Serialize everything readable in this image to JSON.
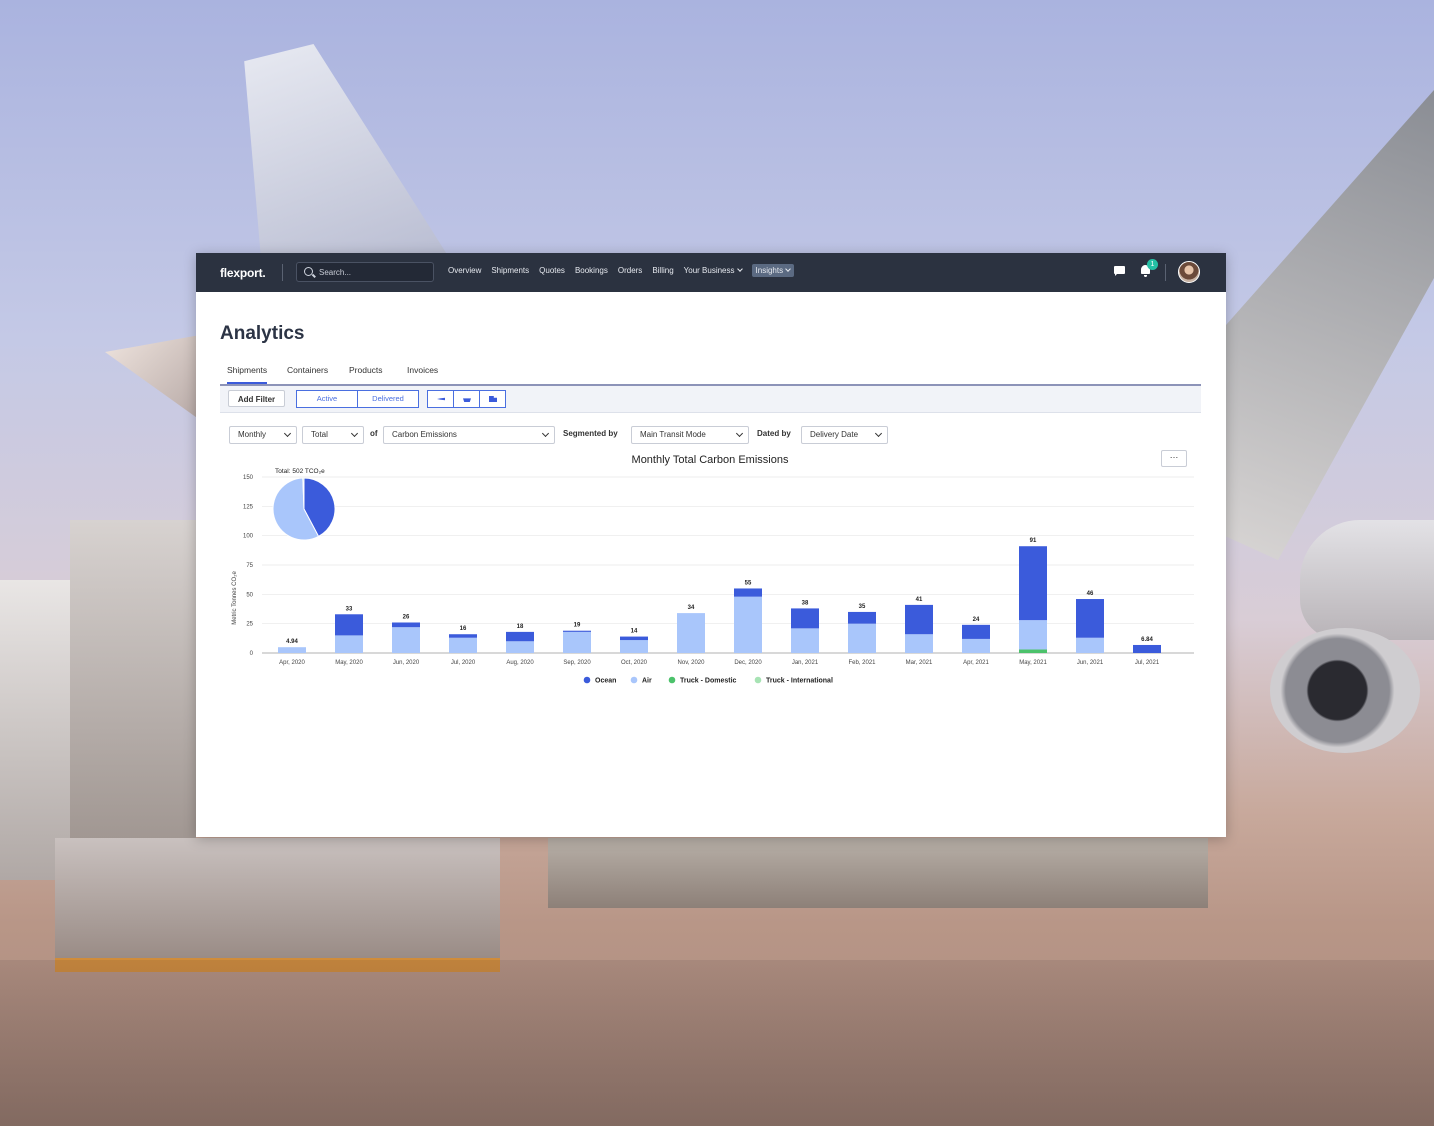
{
  "app": {
    "logo": "flexport.",
    "search_placeholder": "Search...",
    "nav": [
      "Overview",
      "Shipments",
      "Quotes",
      "Bookings",
      "Orders",
      "Billing",
      "Your Business",
      "Insights"
    ],
    "notification_count": "1"
  },
  "page": {
    "title": "Analytics",
    "tabs": [
      "Shipments",
      "Containers",
      "Products",
      "Invoices"
    ],
    "active_tab": "Shipments"
  },
  "filters": {
    "add_filter": "Add Filter",
    "status_segments": [
      "Active",
      "Delivered"
    ],
    "mode_icons": [
      "plane-icon",
      "ship-icon",
      "truck-icon"
    ]
  },
  "controls": {
    "interval": "Monthly",
    "aggregation": "Total",
    "of_label": "of",
    "metric": "Carbon Emissions",
    "segmented_label": "Segmented by",
    "segment": "Main Transit Mode",
    "dated_label": "Dated by",
    "date_field": "Delivery Date",
    "more": "…"
  },
  "colors": {
    "ocean": "#3b5bdb",
    "air": "#a9c6fb",
    "truck_domestic": "#4cc26b",
    "truck_international": "#a7e3b4",
    "nav_bg": "#2b3240",
    "accent": "#3b5bdb"
  },
  "chart_data": {
    "type": "bar",
    "stacked": true,
    "title": "Monthly Total Carbon Emissions",
    "ylabel": "Metric Tonnes CO₂e",
    "ylim": [
      0,
      150
    ],
    "yticks": [
      0,
      25,
      50,
      75,
      100,
      125,
      150
    ],
    "grid": true,
    "legend_position": "bottom-center",
    "categories": [
      "Apr, 2020",
      "May, 2020",
      "Jun, 2020",
      "Jul, 2020",
      "Aug, 2020",
      "Sep, 2020",
      "Oct, 2020",
      "Nov, 2020",
      "Dec, 2020",
      "Jan, 2021",
      "Feb, 2021",
      "Mar, 2021",
      "Apr, 2021",
      "May, 2021",
      "Jun, 2021",
      "Jul, 2021"
    ],
    "totals": [
      "4.94",
      "33",
      "26",
      "16",
      "18",
      "19",
      "14",
      "34",
      "55",
      "38",
      "35",
      "41",
      "24",
      "91",
      "46",
      "6.84"
    ],
    "series": [
      {
        "name": "Ocean",
        "color": "#3b5bdb",
        "values": [
          0,
          18,
          4,
          3,
          8,
          1,
          3,
          0,
          7,
          17,
          10,
          25,
          12,
          63,
          33,
          6.84
        ]
      },
      {
        "name": "Air",
        "color": "#a9c6fb",
        "values": [
          4.94,
          15,
          22,
          13,
          10,
          18,
          11,
          34,
          48,
          21,
          25,
          16,
          12,
          25,
          13,
          0
        ]
      },
      {
        "name": "Truck - Domestic",
        "color": "#4cc26b",
        "values": [
          0,
          0,
          0,
          0,
          0,
          0,
          0,
          0,
          0,
          0,
          0,
          0,
          0,
          3,
          0,
          0
        ]
      },
      {
        "name": "Truck - International",
        "color": "#a7e3b4",
        "values": [
          0,
          0,
          0,
          0,
          0,
          0,
          0,
          0,
          0,
          0,
          0,
          0,
          0,
          0,
          0,
          0
        ]
      }
    ],
    "pie": {
      "label": "Total: 502 TCO₂e",
      "slices": [
        {
          "name": "Ocean",
          "value": 212
        },
        {
          "name": "Air",
          "value": 287
        },
        {
          "name": "Truck - Domestic",
          "value": 3
        }
      ]
    }
  }
}
